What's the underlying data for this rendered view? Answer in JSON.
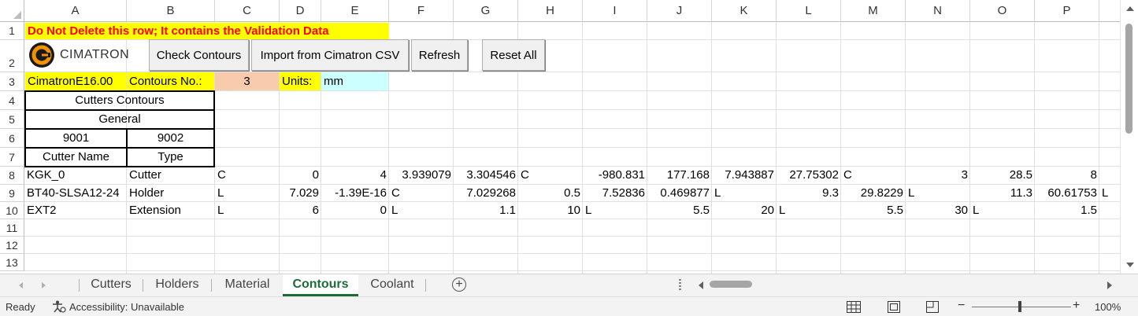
{
  "column_headers": [
    "A",
    "B",
    "C",
    "D",
    "E",
    "F",
    "G",
    "H",
    "I",
    "J",
    "K",
    "L",
    "M",
    "N",
    "O",
    "P"
  ],
  "row_headers": [
    "1",
    "2",
    "3",
    "4",
    "5",
    "6",
    "7",
    "8",
    "9",
    "10",
    "11",
    "12",
    "13"
  ],
  "banner": "Do Not Delete this row; It contains the Validation Data",
  "logo_text": "CIMATRON",
  "buttons": {
    "check_contours": "Check Contours",
    "import_csv": "Import from Cimatron CSV",
    "refresh": "Refresh",
    "reset_all": "Reset All"
  },
  "row3": {
    "version": "CimatronE16.00",
    "contours_label": "Contours No.:",
    "contours_value": "3",
    "units_label": "Units:",
    "units_value": "mm"
  },
  "table_header": {
    "title": "Cutters Contours",
    "subtitle": "General",
    "code_a": "9001",
    "code_b": "9002",
    "col_name": "Cutter Name",
    "col_type": "Type"
  },
  "data_rows": [
    [
      "KGK_0",
      "Cutter",
      "C",
      "0",
      "4",
      "3.939079",
      "3.304546",
      "C",
      "-980.831",
      "177.168",
      "7.943887",
      "27.75302",
      "C",
      "3",
      "28.5",
      "8"
    ],
    [
      "BT40-SLSA12-24",
      "Holder",
      "L",
      "7.029",
      "-1.39E-16",
      "C",
      "7.029268",
      "0.5",
      "7.52836",
      "0.469877",
      "L",
      "9.3",
      "29.8229",
      "L",
      "11.3",
      "60.61753"
    ],
    [
      "EXT2",
      "Extension",
      "L",
      "6",
      "0",
      "L",
      "1.1",
      "10",
      "L",
      "5.5",
      "20",
      "L",
      "5.5",
      "30",
      "L",
      "1.5"
    ]
  ],
  "row9_overflow": "L",
  "sheet_tabs": [
    "Cutters",
    "Holders",
    "Material",
    "Contours",
    "Coolant"
  ],
  "active_tab": "Contours",
  "status": {
    "ready": "Ready",
    "accessibility": "Accessibility: Unavailable",
    "zoom": "100%"
  },
  "colors": {
    "banner_text": "#ff0000",
    "highlight": "#ffff00",
    "peach": "#f8cbad",
    "cyan": "#ccffff",
    "accent": "#1e6b3a",
    "logo_orange": "#f39200"
  }
}
